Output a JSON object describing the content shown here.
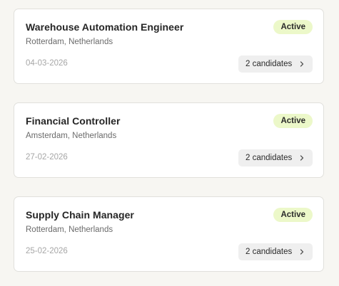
{
  "jobs": [
    {
      "title": "Warehouse Automation Engineer",
      "location": "Rotterdam, Netherlands",
      "date": "04-03-2026",
      "status": "Active",
      "candidates": "2 candidates"
    },
    {
      "title": "Financial Controller",
      "location": "Amsterdam, Netherlands",
      "date": "27-02-2026",
      "status": "Active",
      "candidates": "2 candidates"
    },
    {
      "title": "Supply Chain Manager",
      "location": "Rotterdam, Netherlands",
      "date": "25-02-2026",
      "status": "Active",
      "candidates": "2 candidates"
    }
  ],
  "colors": {
    "page_background": "#f7f6f2",
    "card_background": "#ffffff",
    "status_badge_active": "#ecf8c9",
    "candidates_button": "#efefef"
  },
  "icons": {
    "candidates_button": "chevron-right-icon"
  }
}
